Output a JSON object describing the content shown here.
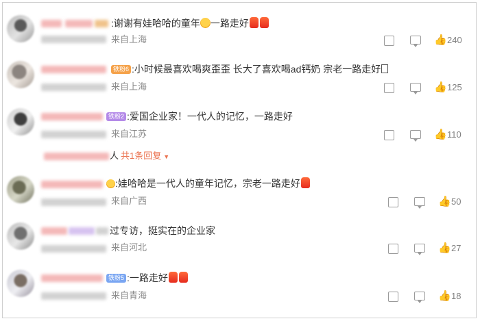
{
  "comments": [
    {
      "text": "谢谢有娃哈哈的童年",
      "text_tail": "一路走好",
      "location": "来自上海",
      "likes": "240"
    },
    {
      "badge": "铁粉6",
      "text": "小时候最喜欢喝爽歪歪 长大了喜欢喝ad钙奶 宗老一路走好",
      "text_tail": "",
      "location": "来自上海",
      "likes": "125"
    },
    {
      "badge": "铁粉2",
      "text": "爱国企业家！一代人的记忆，一路走好",
      "location": "来自江苏",
      "likes": "110"
    },
    {
      "text": "娃哈哈是一代人的童年记忆，宗老一路走好",
      "location": "来自广西",
      "likes": "50"
    },
    {
      "text": "过专访，挺实在的企业家",
      "location": "来自河北",
      "likes": "27"
    },
    {
      "badge": "铁粉5",
      "text": "一路走好",
      "location": "来自青海",
      "likes": "18"
    }
  ],
  "reply": {
    "suffix": "人",
    "more": "共1条回复"
  },
  "icons": {
    "share": "share-icon",
    "comment": "comment-icon",
    "like": "thumbs-up-icon",
    "expand": "caret-down-icon"
  },
  "colors": {
    "accent": "#eb7350",
    "text": "#333333",
    "meta": "#8a8a8a"
  }
}
